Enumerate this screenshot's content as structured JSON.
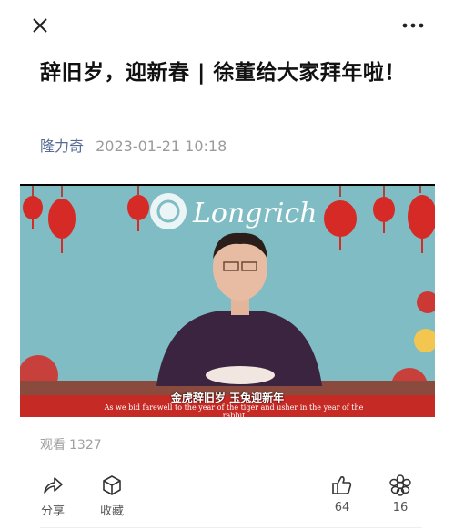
{
  "article": {
    "title": "辞旧岁，迎新春 | 徐董给大家拜年啦！",
    "author": "隆力奇",
    "date": "2023-01-21 10:18"
  },
  "video": {
    "brand": "Longrich",
    "subtitle_cn": "金虎辞旧岁 玉兔迎新年",
    "subtitle_en": "As we bid farewell to the year of the tiger and usher in the year of the rabbit"
  },
  "stats": {
    "views_label": "观看",
    "views_count": "1327"
  },
  "actions": {
    "share": "分享",
    "favorite": "收藏",
    "like_count": "64",
    "wow_count": "16"
  },
  "colors": {
    "author": "#576b95",
    "video_bg": "#7fbcc3",
    "lantern": "#d52a25"
  }
}
